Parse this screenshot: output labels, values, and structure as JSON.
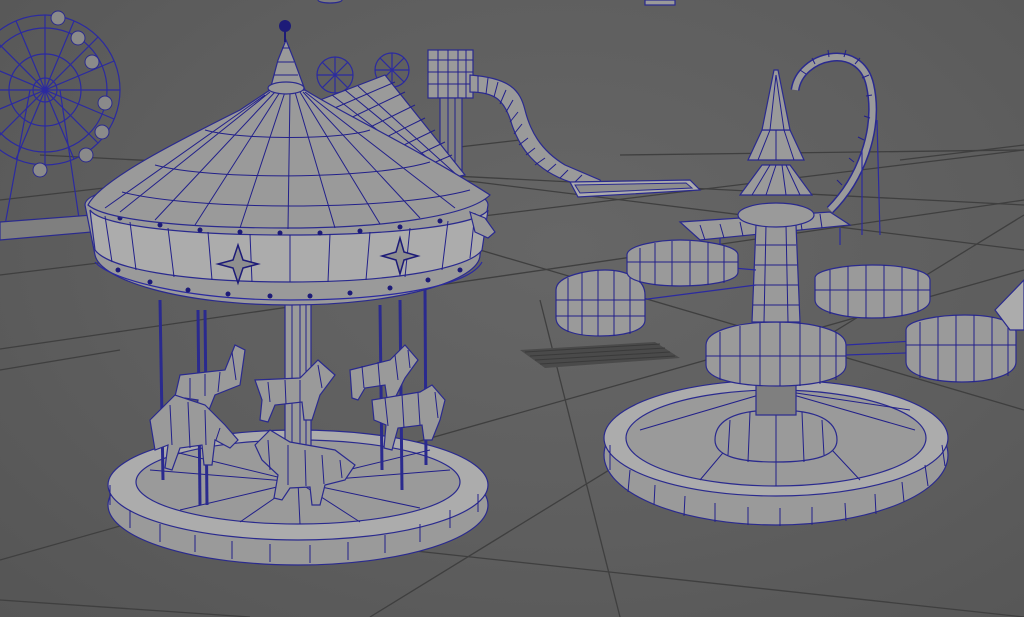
{
  "scene": {
    "background_color": "#5d5d5d",
    "wire_color": "#22208a",
    "mesh_color": "#9a9a9a",
    "objects": [
      "ferris-wheel",
      "carousel",
      "spiral-slide",
      "tea-cup-ride",
      "rollercoaster-loop"
    ]
  }
}
